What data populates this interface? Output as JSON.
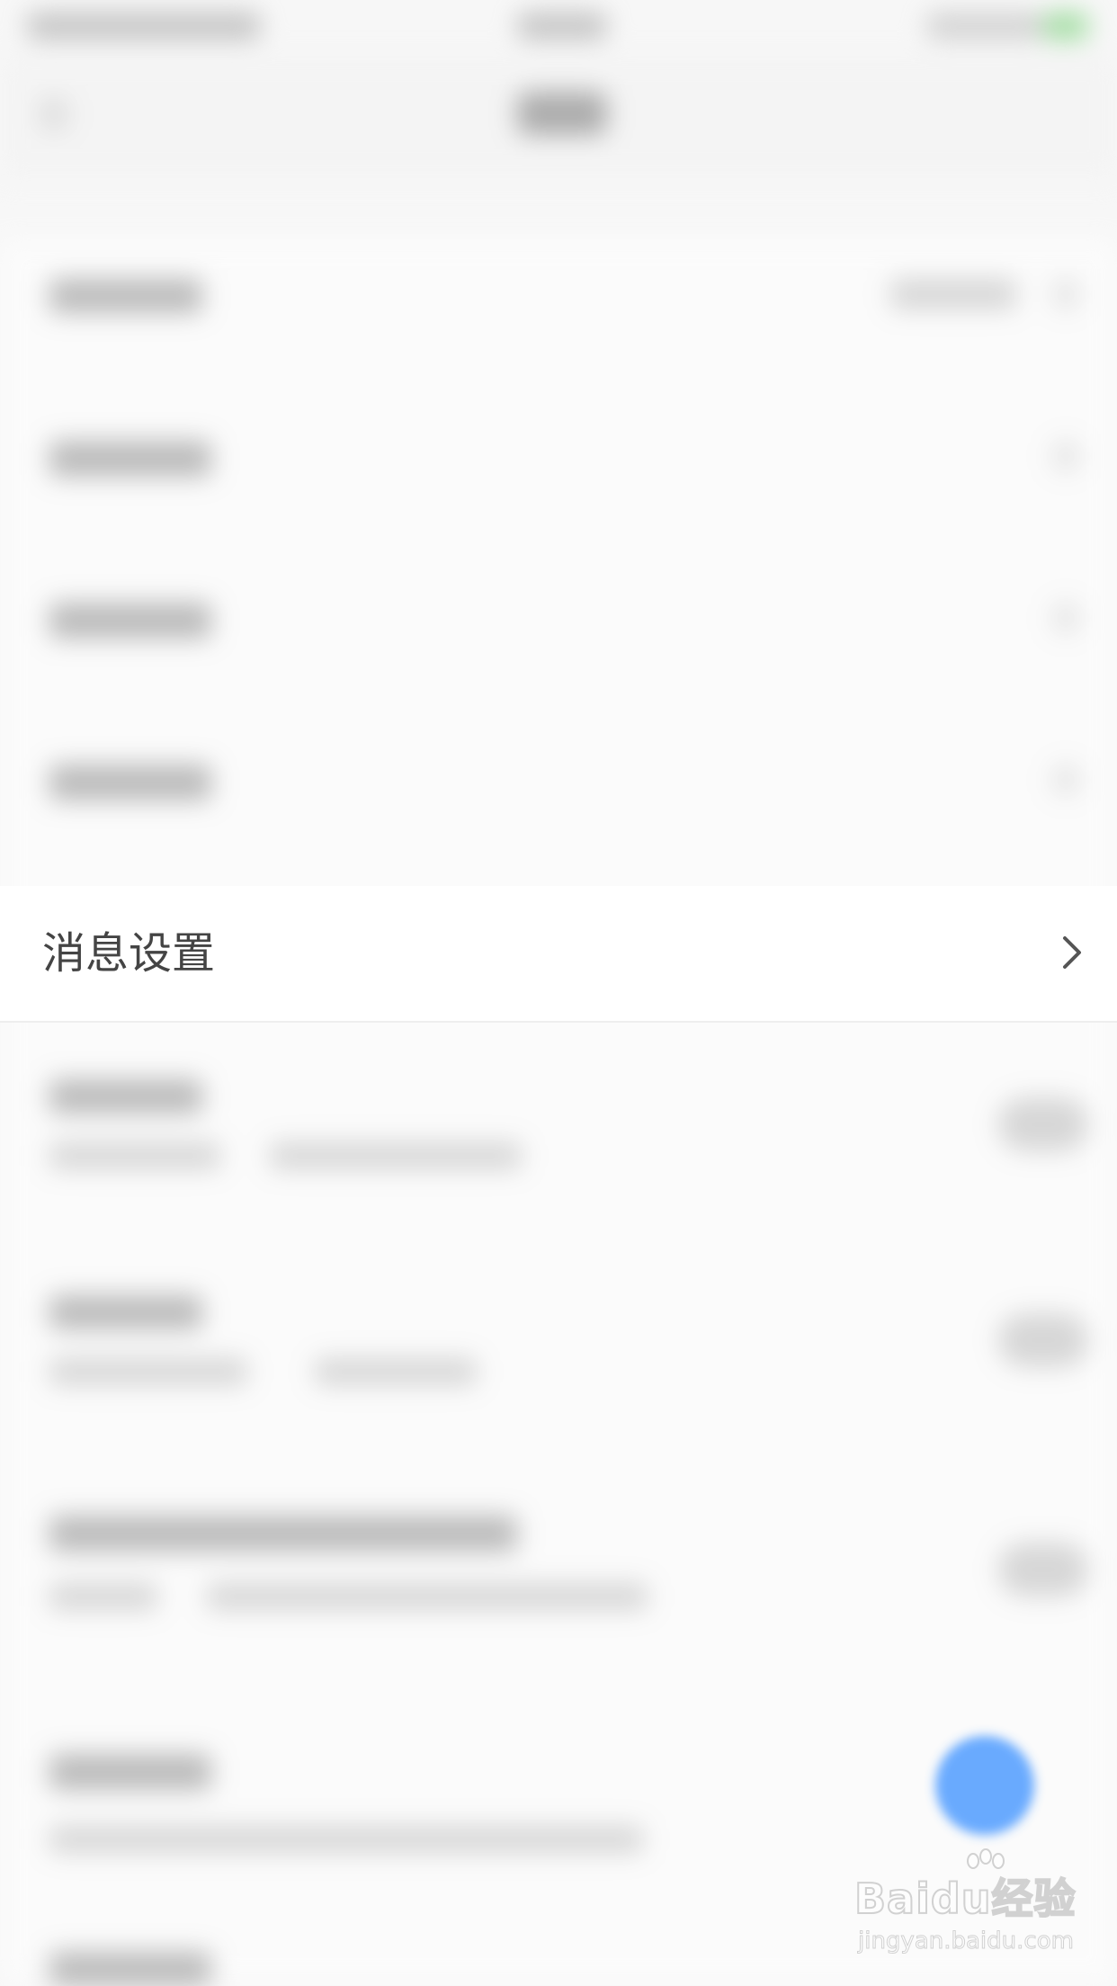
{
  "message_settings_row": {
    "label": "消息设置"
  },
  "watermark": {
    "brand": "Baidu经验",
    "url": "jingyan.baidu.com"
  },
  "colors": {
    "fab_accent": "#5aa2ff",
    "label_text": "#444444"
  },
  "icons": {
    "row_chevron": "chevron-right-icon",
    "watermark_logo": "baidu-paw-icon"
  }
}
